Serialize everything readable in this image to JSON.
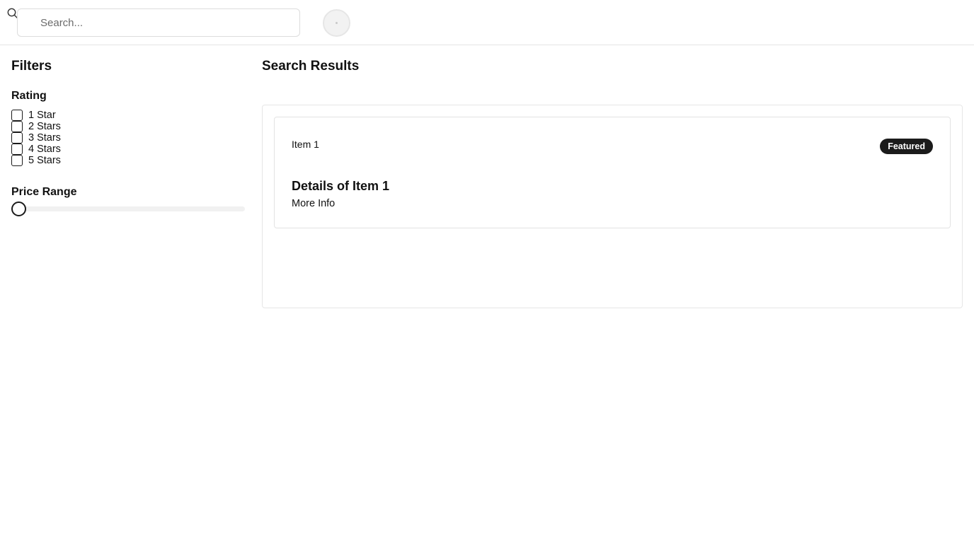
{
  "header": {
    "search": {
      "placeholder": "Search...",
      "value": "",
      "icon": "search-icon"
    },
    "avatar": {
      "icon": "avatar-icon"
    }
  },
  "sidebar": {
    "title": "Filters",
    "rating": {
      "title": "Rating",
      "options": [
        {
          "label": "1 Star",
          "checked": false
        },
        {
          "label": "2 Stars",
          "checked": false
        },
        {
          "label": "3 Stars",
          "checked": false
        },
        {
          "label": "4 Stars",
          "checked": false
        },
        {
          "label": "5 Stars",
          "checked": false
        }
      ]
    },
    "price_range": {
      "title": "Price Range",
      "value_fraction": 0
    }
  },
  "main": {
    "title": "Search Results",
    "results": [
      {
        "label": "Item 1",
        "badge": "Featured",
        "heading": "Details of Item 1",
        "link": "More Info"
      }
    ]
  },
  "colors": {
    "badge_bg": "#1b1b1b",
    "badge_text": "#ffffff",
    "border": "#e5e5e5",
    "text": "#111111"
  }
}
